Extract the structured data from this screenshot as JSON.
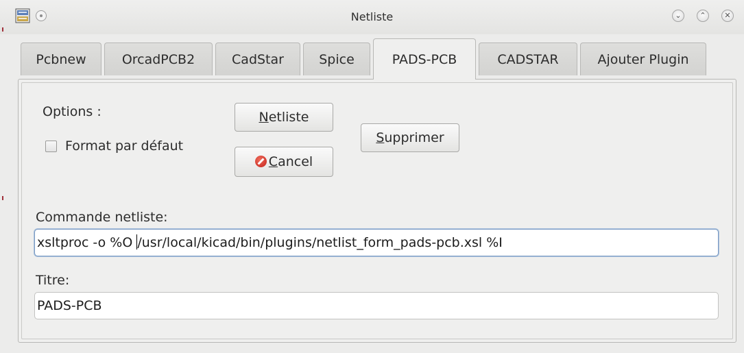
{
  "window": {
    "title": "Netliste",
    "controls": {
      "minimize": "⌄",
      "maximize": "⌃",
      "close": "✕"
    }
  },
  "tabs": [
    {
      "label": "Pcbnew",
      "active": false
    },
    {
      "label": "OrcadPCB2",
      "active": false
    },
    {
      "label": "CadStar",
      "active": false
    },
    {
      "label": "Spice",
      "active": false
    },
    {
      "label": "PADS-PCB",
      "active": true
    },
    {
      "label": "CADSTAR",
      "active": false
    },
    {
      "label": "Ajouter Plugin",
      "active": false
    }
  ],
  "panel": {
    "options_label": "Options :",
    "default_format_label": "Format par défaut",
    "default_format_checked": false,
    "netlist_button": {
      "mnemonic": "N",
      "rest": "etliste"
    },
    "cancel_button": {
      "mnemonic": "C",
      "rest": "ancel",
      "icon": "cancel-icon"
    },
    "delete_button": {
      "mnemonic": "S",
      "rest": "upprimer"
    },
    "command_label": "Commande netliste:",
    "command_value_before_caret": "xsltproc -o %O ",
    "command_value_after_caret": "/usr/local/kicad/bin/plugins/netlist_form_pads-pcb.xsl %I",
    "title_label": "Titre:",
    "title_value": "PADS-PCB"
  },
  "colors": {
    "window_bg": "#ececeb",
    "focus_border": "#7d9cc4",
    "cancel_icon": "#c4221a"
  }
}
